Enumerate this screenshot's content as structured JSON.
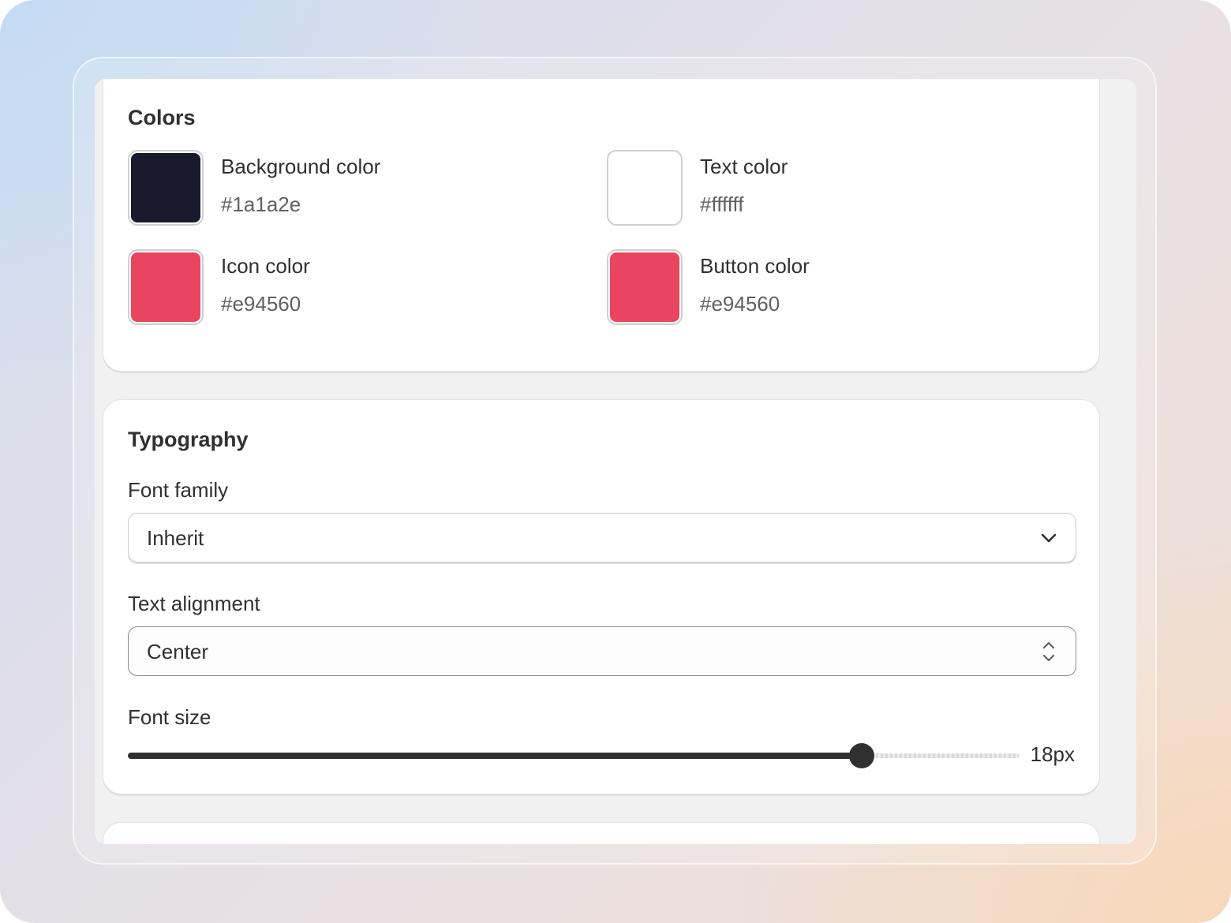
{
  "colors": {
    "title": "Colors",
    "items": [
      {
        "label": "Background color",
        "value": "#1a1a2e"
      },
      {
        "label": "Text color",
        "value": "#ffffff"
      },
      {
        "label": "Icon color",
        "value": "#e94560"
      },
      {
        "label": "Button color",
        "value": "#e94560"
      }
    ]
  },
  "typography": {
    "title": "Typography",
    "font_family": {
      "label": "Font family",
      "value": "Inherit"
    },
    "text_alignment": {
      "label": "Text alignment",
      "value": "Center"
    },
    "font_size": {
      "label": "Font size",
      "value_text": "18px",
      "fraction": 0.823
    }
  }
}
